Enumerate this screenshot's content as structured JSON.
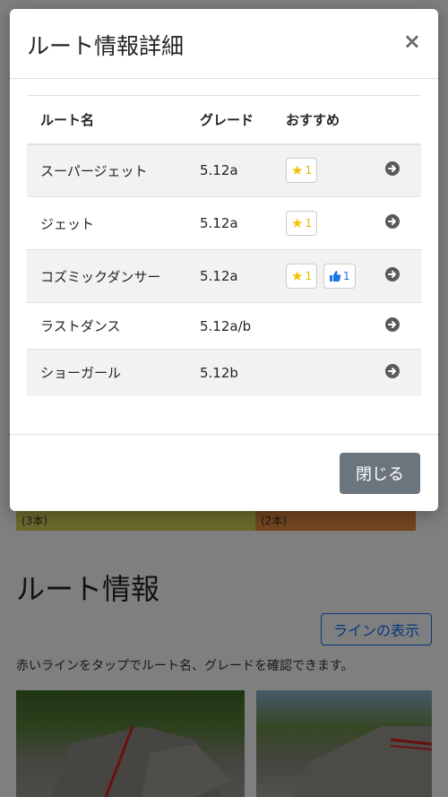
{
  "background": {
    "bar_segments": [
      {
        "label": "(3本)",
        "color": "#d6d55a"
      },
      {
        "label": "(2本)",
        "color": "#e68a3e"
      }
    ],
    "heading": "ルート情報",
    "line_button": "ラインの表示",
    "description": "赤いラインをタップでルート名、グレードを確認できます。"
  },
  "modal": {
    "title": "ルート情報詳細",
    "close_symbol": "×",
    "table": {
      "headers": {
        "name": "ルート名",
        "grade": "グレード",
        "recommend": "おすすめ"
      },
      "rows": [
        {
          "name": "スーパージェット",
          "grade": "5.12a",
          "stars": "1",
          "thumbs": null
        },
        {
          "name": "ジェット",
          "grade": "5.12a",
          "stars": "1",
          "thumbs": null
        },
        {
          "name": "コズミックダンサー",
          "grade": "5.12a",
          "stars": "1",
          "thumbs": "1"
        },
        {
          "name": "ラストダンス",
          "grade": "5.12a/b",
          "stars": null,
          "thumbs": null
        },
        {
          "name": "ショーガール",
          "grade": "5.12b",
          "stars": null,
          "thumbs": null
        }
      ]
    },
    "footer_close": "閉じる"
  },
  "colors": {
    "star": "#f2c200",
    "thumb": "#1a73e8",
    "close_button": "#6c757d",
    "link_blue": "#0d6efd"
  }
}
